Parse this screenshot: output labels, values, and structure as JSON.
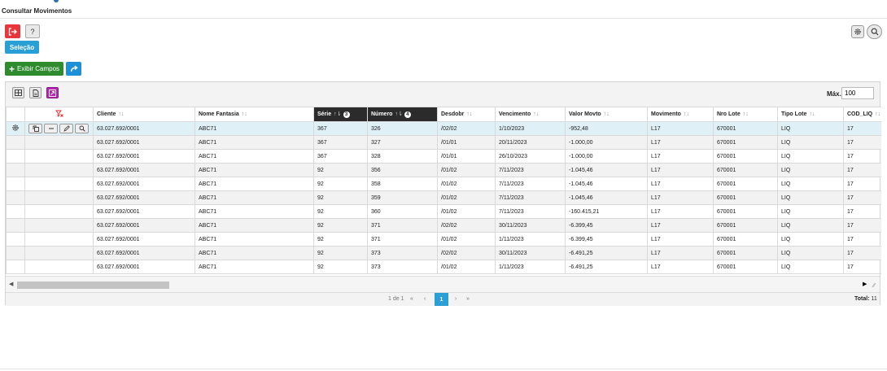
{
  "app": {
    "title": "Consultar Movimentos"
  },
  "toolbar": {
    "help_label": "?",
    "selecao_label": "Seleção"
  },
  "grid_toolbar": {
    "exibir_label": "Exibir Campos",
    "max_label": "Máx.",
    "max_value": "100"
  },
  "table": {
    "columns": [
      {
        "label": "Cliente",
        "sorted": false,
        "badge": ""
      },
      {
        "label": "Nome Fantasia",
        "sorted": false,
        "badge": ""
      },
      {
        "label": "Série",
        "sorted": true,
        "badge": "3"
      },
      {
        "label": "Número",
        "sorted": true,
        "badge": "4"
      },
      {
        "label": "Desdobr",
        "sorted": false,
        "badge": ""
      },
      {
        "label": "Vencimento",
        "sorted": false,
        "badge": ""
      },
      {
        "label": "Valor Movto",
        "sorted": false,
        "badge": ""
      },
      {
        "label": "Movimento",
        "sorted": false,
        "badge": ""
      },
      {
        "label": "Nro Lote",
        "sorted": false,
        "badge": ""
      },
      {
        "label": "Tipo Lote",
        "sorted": false,
        "badge": ""
      },
      {
        "label": "COD_LIQ",
        "sorted": false,
        "badge": ""
      }
    ],
    "rows": [
      [
        "63.027.692/0001",
        "ABC71",
        "367",
        "326",
        "/02/02",
        "1/10/2023",
        "-952,48",
        "L17",
        "670001",
        "LIQ",
        "17"
      ],
      [
        "63.027.692/0001",
        "ABC71",
        "367",
        "327",
        "/01/01",
        "20/11/2023",
        "-1.000,00",
        "L17",
        "670001",
        "LIQ",
        "17"
      ],
      [
        "63.027.692/0001",
        "ABC71",
        "367",
        "328",
        "/01/01",
        "26/10/2023",
        "-1.000,00",
        "L17",
        "670001",
        "LIQ",
        "17"
      ],
      [
        "63.027.692/0001",
        "ABC71",
        "92",
        "356",
        "/01/02",
        "7/11/2023",
        "-1.045,46",
        "L17",
        "670001",
        "LIQ",
        "17"
      ],
      [
        "63.027.692/0001",
        "ABC71",
        "92",
        "358",
        "/01/02",
        "7/11/2023",
        "-1.045,46",
        "L17",
        "670001",
        "LIQ",
        "17"
      ],
      [
        "63.027.692/0001",
        "ABC71",
        "92",
        "359",
        "/01/02",
        "7/11/2023",
        "-1.045,46",
        "L17",
        "670001",
        "LIQ",
        "17"
      ],
      [
        "63.027.692/0001",
        "ABC71",
        "92",
        "360",
        "/01/02",
        "7/11/2023",
        "-160.415,21",
        "L17",
        "670001",
        "LIQ",
        "17"
      ],
      [
        "63.027.692/0001",
        "ABC71",
        "92",
        "371",
        "/02/02",
        "30/11/2023",
        "-6.399,45",
        "L17",
        "670001",
        "LIQ",
        "17"
      ],
      [
        "63.027.692/0001",
        "ABC71",
        "92",
        "371",
        "/01/02",
        "1/11/2023",
        "-6.399,45",
        "L17",
        "670001",
        "LIQ",
        "17"
      ],
      [
        "63.027.692/0001",
        "ABC71",
        "92",
        "373",
        "/02/02",
        "30/11/2023",
        "-6.491,25",
        "L17",
        "670001",
        "LIQ",
        "17"
      ],
      [
        "63.027.692/0001",
        "ABC71",
        "92",
        "373",
        "/01/02",
        "1/11/2023",
        "-6.491,25",
        "L17",
        "670001",
        "LIQ",
        "17"
      ]
    ]
  },
  "pager": {
    "info": "1 de 1",
    "first": "«",
    "prev": "‹",
    "current": "1",
    "next": "›",
    "last": "»",
    "total_label": "Total:",
    "total_value": "11"
  },
  "colors": {
    "accent": "#2a9fd6",
    "exit": "#e8363d",
    "exibir": "#2e8b2e",
    "sorted_header": "#2b2b2b",
    "selected_row": "#dff0f7",
    "magenta_button": "#b327b3"
  },
  "icons": [
    "exit-icon",
    "gear-icon",
    "search-icon",
    "plus-icon",
    "share-icon",
    "grid-icon",
    "document-icon",
    "expand-icon",
    "clear-filter-icon",
    "copy-icon",
    "minus-icon",
    "pencil-icon",
    "sort-icon",
    "scroll-left-icon",
    "scroll-right-icon",
    "resize-icon"
  ]
}
